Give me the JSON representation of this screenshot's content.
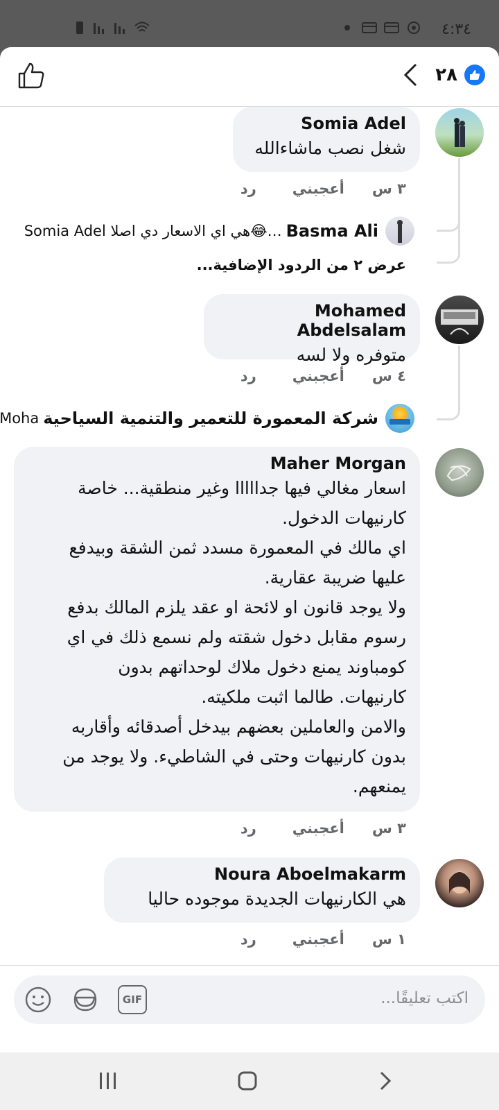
{
  "status_bar": {
    "time": "٤:٣٤"
  },
  "header": {
    "reaction_count": "٢٨"
  },
  "comments": [
    {
      "name": "Somia Adel",
      "text": "شغل نصب ماشاءالله",
      "time": "٣ س",
      "like_label": "أعجبني",
      "reply_label": "رد",
      "reply_preview": {
        "name": "Basma Ali",
        "text": "…😂هي اي الاسعار دي اصلا Somia Adel"
      },
      "more_replies": "عرض ٢ من الردود الإضافية..."
    },
    {
      "name": "Mohamed Abdelsalam",
      "text": "متوفره ولا لسه",
      "time": "٤ س",
      "like_label": "أعجبني",
      "reply_label": "رد",
      "reply_preview": {
        "name": "شركة المعمورة للتعمير والتنمية السياحية",
        "text": "Moha..."
      }
    },
    {
      "name": "Maher Morgan",
      "text": "اسعار مغالي فيها جدااااا وغير منطقية... خاصة\nكارنيهات الدخول.\nاي مالك في المعمورة مسدد ثمن الشقة وبيدفع\nعليها ضريبة عقارية.\nولا يوجد قانون او لائحة او عقد يلزم المالك بدفع\nرسوم مقابل دخول شقته  ولم نسمع ذلك في اي\nكومباوند يمنع دخول ملاك لوحداتهم بدون\nكارنيهات. طالما اثبت ملكيته.\nوالامن والعاملين بعضهم بيدخل أصدقائه وأقاربه\nبدون كارنيهات وحتى في الشاطيء. ولا يوجد من\nيمنعهم.",
      "time": "٣ س",
      "like_label": "أعجبني",
      "reply_label": "رد"
    },
    {
      "name": "Noura Aboelmakarm",
      "text": "هي الكارنيهات الجديدة موجوده حاليا",
      "time": "١ س",
      "like_label": "أعجبني",
      "reply_label": "رد"
    }
  ],
  "composer": {
    "placeholder": "اكتب تعليقًا...",
    "gif_label": "GIF"
  },
  "colors": {
    "accent": "#1877f2",
    "bubble": "#f0f2f5",
    "meta": "#65676b"
  }
}
